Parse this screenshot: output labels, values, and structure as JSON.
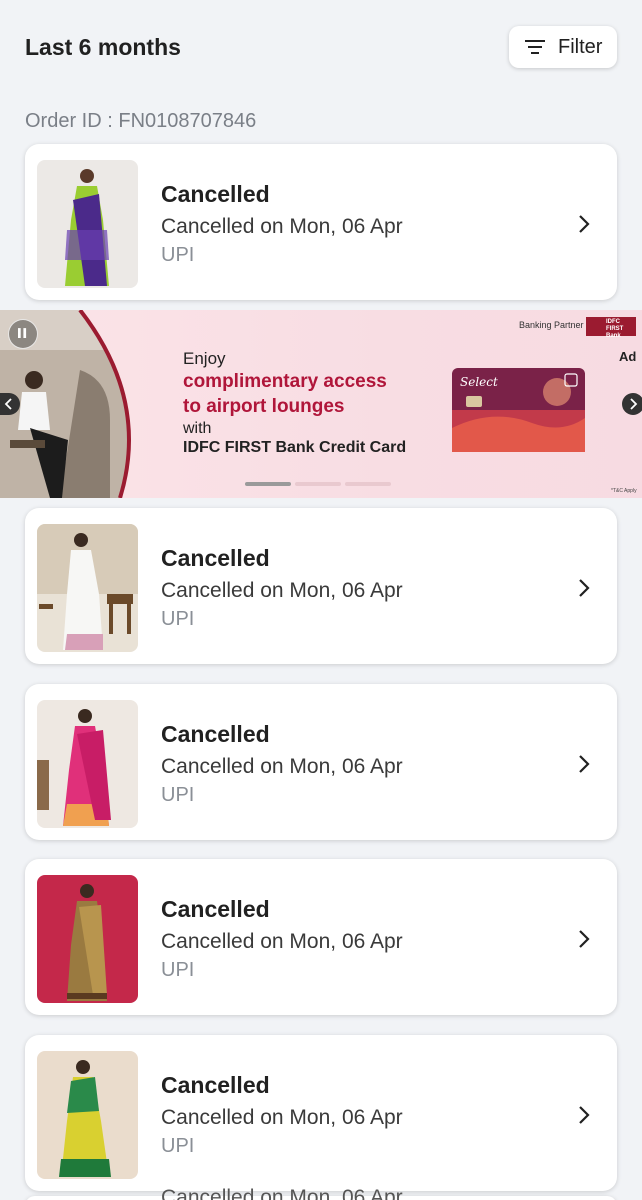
{
  "header": {
    "title": "Last 6 months",
    "filter_label": "Filter"
  },
  "order": {
    "id_text": "Order ID : FN0108707846"
  },
  "banner": {
    "enjoy": "Enjoy",
    "headline_1": "complimentary access",
    "headline_2": "to airport lounges",
    "with": "with",
    "bank_line": "IDFC FIRST Bank Credit Card",
    "partner_label": "Banking Partner",
    "logo_text": "IDFC FIRST Bank",
    "ad_label": "Ad",
    "tc": "*T&C Apply",
    "card_brand": "Select",
    "active_slide": 1,
    "slide_count": 3,
    "accent": "#b0163a"
  },
  "orders": [
    {
      "status": "Cancelled",
      "date": "Cancelled on Mon, 06 Apr",
      "payment": "UPI",
      "thumb": "purple-green-saree"
    },
    {
      "status": "Cancelled",
      "date": "Cancelled on Mon, 06 Apr",
      "payment": "UPI",
      "thumb": "white-saree"
    },
    {
      "status": "Cancelled",
      "date": "Cancelled on Mon, 06 Apr",
      "payment": "UPI",
      "thumb": "pink-saree"
    },
    {
      "status": "Cancelled",
      "date": "Cancelled on Mon, 06 Apr",
      "payment": "UPI",
      "thumb": "brown-saree"
    },
    {
      "status": "Cancelled",
      "date": "Cancelled on Mon, 06 Apr",
      "payment": "UPI",
      "thumb": "yellow-green-saree"
    }
  ],
  "partial_next": "Cancelled on Mon, 06 Apr",
  "colors": {
    "background": "#f1f3f6",
    "text": "#212121",
    "muted": "#8a8f96"
  }
}
